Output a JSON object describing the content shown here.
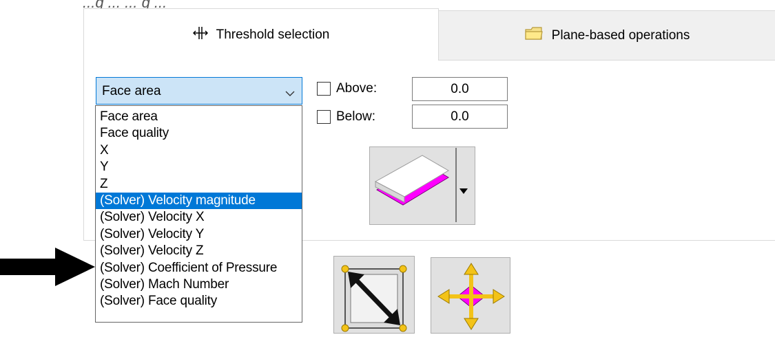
{
  "caption": "...g ... ... g ...",
  "tabs": [
    {
      "label": "Threshold selection",
      "icon": "threshold-icon",
      "active": true
    },
    {
      "label": "Plane-based operations",
      "icon": "folder-icon",
      "active": false
    }
  ],
  "combo": {
    "value": "Face area",
    "options": [
      "Face area",
      "Face quality",
      "X",
      "Y",
      "Z",
      "(Solver) Velocity magnitude",
      "(Solver) Velocity X",
      "(Solver) Velocity Y",
      "(Solver) Velocity Z",
      "(Solver) Coefficient of Pressure",
      "(Solver) Mach Number",
      "(Solver) Face quality"
    ],
    "highlighted_index": 5
  },
  "above": {
    "label": "Above:",
    "value": "0.0",
    "checked": false
  },
  "below": {
    "label": "Below:",
    "value": "0.0",
    "checked": false
  },
  "colors": {
    "accent": "#0078d7",
    "combo_bg": "#cce4f7",
    "magenta": "#ff00ff",
    "arrow": "#000000"
  },
  "icons": [
    "threshold-icon",
    "folder-icon",
    "chevron-down-icon",
    "plane-select-icon",
    "dropdown-arrow-icon",
    "resize-icon",
    "move-icon",
    "annotation-arrow"
  ]
}
